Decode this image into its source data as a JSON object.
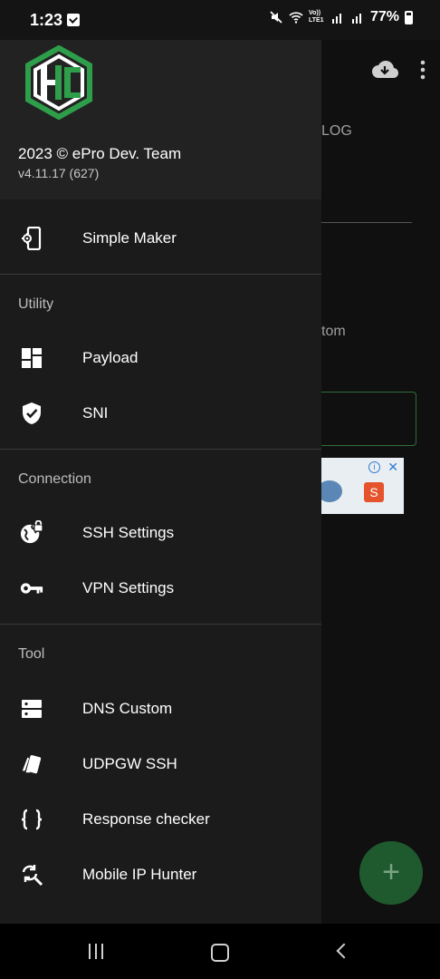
{
  "status_bar": {
    "time": "1:23",
    "network": "Vo)) LTE1",
    "battery": "77%"
  },
  "background": {
    "tab_fragment": "LOG",
    "text_fragment": "tom",
    "fab_label": "+"
  },
  "drawer": {
    "header": {
      "title": "2023 © ePro Dev. Team",
      "version": "v4.11.17 (627)"
    },
    "top_item": {
      "label": "Simple Maker",
      "icon": "phone-settings-icon"
    },
    "sections": [
      {
        "title": "Utility",
        "items": [
          {
            "label": "Payload",
            "icon": "dashboard-icon"
          },
          {
            "label": "SNI",
            "icon": "shield-check-icon"
          }
        ]
      },
      {
        "title": "Connection",
        "items": [
          {
            "label": "SSH Settings",
            "icon": "globe-lock-icon"
          },
          {
            "label": "VPN Settings",
            "icon": "key-icon"
          }
        ]
      },
      {
        "title": "Tool",
        "items": [
          {
            "label": "DNS Custom",
            "icon": "dns-icon"
          },
          {
            "label": "UDPGW SSH",
            "icon": "cards-icon"
          },
          {
            "label": "Response checker",
            "icon": "braces-icon"
          },
          {
            "label": "Mobile IP Hunter",
            "icon": "search-refresh-icon"
          }
        ]
      }
    ]
  },
  "colors": {
    "drawer_bg": "#1b1b1b",
    "header_bg": "#222222",
    "accent_green": "#2e9e4a",
    "fab": "#1f5a2e"
  }
}
